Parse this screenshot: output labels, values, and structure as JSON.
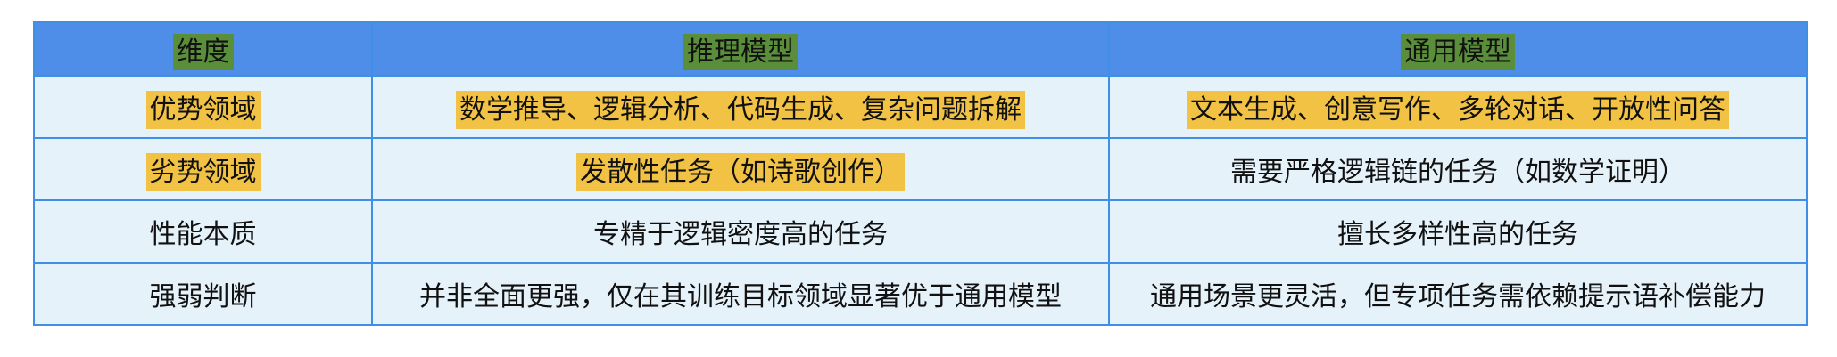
{
  "table": {
    "headers": [
      "维度",
      "推理模型",
      "通用模型"
    ],
    "rows": [
      [
        "优势领域",
        "数学推导、逻辑分析、代码生成、复杂问题拆解",
        "文本生成、创意写作、多轮对话、开放性问答"
      ],
      [
        "劣势领域",
        "发散性任务（如诗歌创作）",
        "需要严格逻辑链的任务（如数学证明）"
      ],
      [
        "性能本质",
        "专精于逻辑密度高的任务",
        "擅长多样性高的任务"
      ],
      [
        "强弱判断",
        "并非全面更强，仅在其训练目标领域显著优于通用模型",
        "通用场景更灵活，但专项任务需依赖提示语补偿能力"
      ]
    ]
  },
  "colors": {
    "header_background": "#4f8ee8",
    "cell_background": "#e6f2f9",
    "border": "#3f8fe6",
    "highlight_green": "#5a8e3a",
    "highlight_yellow": "#f2c244"
  }
}
